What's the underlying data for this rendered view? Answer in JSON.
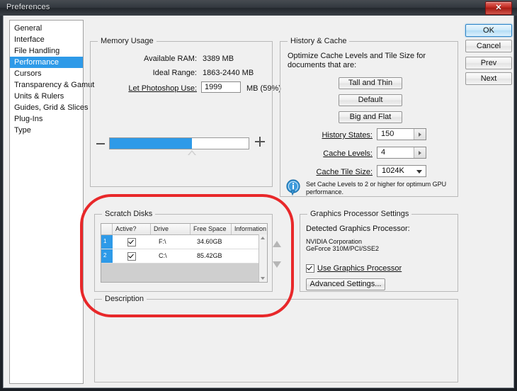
{
  "window": {
    "title": "Preferences",
    "close_label": "✕"
  },
  "sidebar": {
    "items": [
      {
        "label": "General",
        "selected": false
      },
      {
        "label": "Interface",
        "selected": false
      },
      {
        "label": "File Handling",
        "selected": false
      },
      {
        "label": "Performance",
        "selected": true
      },
      {
        "label": "Cursors",
        "selected": false
      },
      {
        "label": "Transparency & Gamut",
        "selected": false
      },
      {
        "label": "Units & Rulers",
        "selected": false
      },
      {
        "label": "Guides, Grid & Slices",
        "selected": false
      },
      {
        "label": "Plug-Ins",
        "selected": false
      },
      {
        "label": "Type",
        "selected": false
      }
    ]
  },
  "memory": {
    "group_title": "Memory Usage",
    "available_ram_label": "Available RAM:",
    "available_ram_value": "3389 MB",
    "ideal_range_label": "Ideal Range:",
    "ideal_range_value": "1863-2440 MB",
    "let_use_label": "Let Photoshop Use:",
    "let_use_value": "1999",
    "let_use_suffix": "MB (59%)",
    "slider_percent": 59,
    "minus_label": "−",
    "plus_label": "+"
  },
  "history": {
    "group_title": "History & Cache",
    "description": "Optimize Cache Levels and Tile Size for documents that are:",
    "buttons": [
      "Tall and Thin",
      "Default",
      "Big and Flat"
    ],
    "history_states_label": "History States:",
    "history_states_value": "150",
    "cache_levels_label": "Cache Levels:",
    "cache_levels_value": "4",
    "cache_tile_label": "Cache Tile Size:",
    "cache_tile_value": "1024K",
    "info_note": "Set Cache Levels to 2 or higher for optimum GPU performance.",
    "info_glyph": "i"
  },
  "scratch": {
    "group_title": "Scratch Disks",
    "columns": [
      "",
      "Active?",
      "Drive",
      "Free Space",
      "Information"
    ],
    "rows": [
      {
        "num": "1",
        "active": true,
        "drive": "F:\\",
        "free_space": "34.60GB",
        "information": ""
      },
      {
        "num": "2",
        "active": true,
        "drive": "C:\\",
        "free_space": "85.42GB",
        "information": ""
      }
    ]
  },
  "gpu": {
    "group_title": "Graphics Processor Settings",
    "detected_label": "Detected Graphics Processor:",
    "vendor": "NVIDIA Corporation",
    "model": "GeForce 310M/PCI/SSE2",
    "use_gpu_label": "Use Graphics Processor",
    "use_gpu_checked": true,
    "advanced_button": "Advanced Settings..."
  },
  "description": {
    "group_title": "Description",
    "text": ""
  },
  "buttons": {
    "ok": "OK",
    "cancel": "Cancel",
    "prev": "Prev",
    "next": "Next"
  },
  "colors": {
    "accent_blue": "#2e9ae8",
    "annotation_red": "#e8282a",
    "dialog_bg": "#f0f0f0"
  }
}
